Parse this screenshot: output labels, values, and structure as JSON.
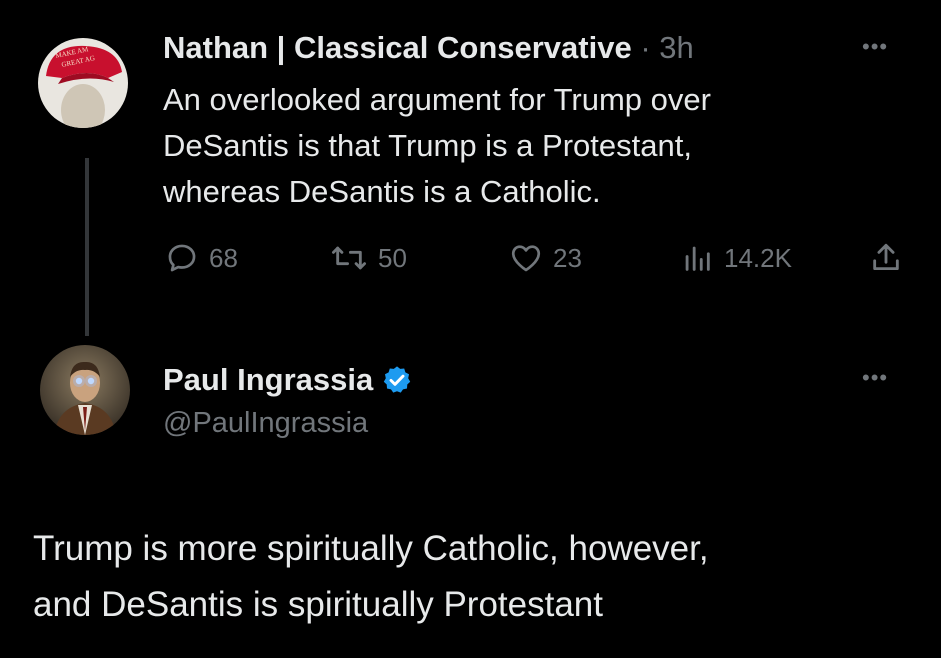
{
  "tweet1": {
    "author_name": "Nathan | Classical Conservative",
    "time": "· 3h",
    "text_lines": [
      "An overlooked argument for Trump over",
      "DeSantis is that Trump is a Protestant,",
      "whereas DeSantis is a Catholic."
    ],
    "avatar_hat_text": [
      "MAKE AM",
      "GREAT AG"
    ],
    "actions": {
      "replies": "68",
      "retweets": "50",
      "likes": "23",
      "views": "14.2K"
    },
    "more_label": "•••"
  },
  "tweet2": {
    "author_name": "Paul Ingrassia",
    "handle": "@PaulIngrassia",
    "more_label": "•••",
    "text_lines": [
      "Trump is more spiritually Catholic, however,",
      "and DeSantis is spiritually Protestant"
    ]
  },
  "colors": {
    "background": "#000000",
    "text": "#e7e9ea",
    "muted": "#71767b",
    "verified": "#1d9bf0",
    "hat_red": "#c8102e"
  },
  "icons": [
    "reply-icon",
    "retweet-icon",
    "like-icon",
    "views-icon",
    "share-icon",
    "verified-badge-icon",
    "more-icon"
  ]
}
